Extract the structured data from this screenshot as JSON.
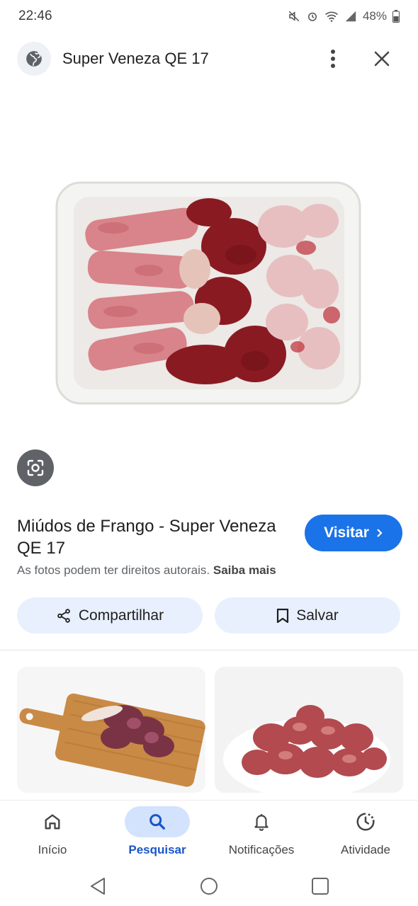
{
  "status_bar": {
    "time": "22:46",
    "battery": "48%"
  },
  "header": {
    "site_title": "Super Veneza QE 17"
  },
  "result": {
    "title": "Miúdos de Frango - Super Veneza QE 17",
    "visit_label": "Visitar",
    "copyright_text": "As fotos podem ter direitos autorais.",
    "learn_more": "Saiba mais"
  },
  "actions": {
    "share_label": "Compartilhar",
    "save_label": "Salvar"
  },
  "bottom_nav": {
    "items": [
      {
        "label": "Início",
        "icon": "home-icon"
      },
      {
        "label": "Pesquisar",
        "icon": "search-icon",
        "active": true
      },
      {
        "label": "Notificações",
        "icon": "bell-icon"
      },
      {
        "label": "Atividade",
        "icon": "activity-icon"
      }
    ]
  },
  "colors": {
    "accent": "#1a73e8",
    "chip_bg": "#e8f0fe",
    "active_nav_bg": "#d3e3fd"
  }
}
